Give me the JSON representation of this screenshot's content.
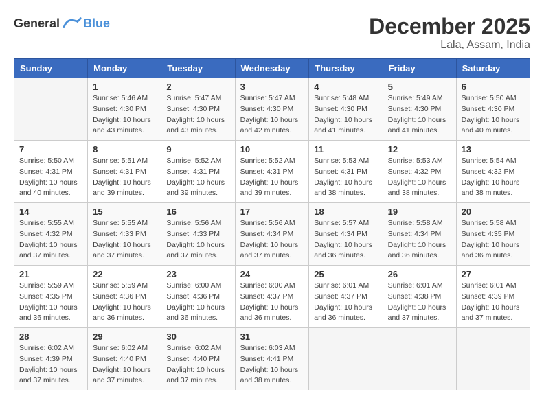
{
  "header": {
    "logo_general": "General",
    "logo_blue": "Blue",
    "month": "December 2025",
    "location": "Lala, Assam, India"
  },
  "weekdays": [
    "Sunday",
    "Monday",
    "Tuesday",
    "Wednesday",
    "Thursday",
    "Friday",
    "Saturday"
  ],
  "weeks": [
    [
      {
        "day": "",
        "sunrise": "",
        "sunset": "",
        "daylight": ""
      },
      {
        "day": "1",
        "sunrise": "Sunrise: 5:46 AM",
        "sunset": "Sunset: 4:30 PM",
        "daylight": "Daylight: 10 hours and 43 minutes."
      },
      {
        "day": "2",
        "sunrise": "Sunrise: 5:47 AM",
        "sunset": "Sunset: 4:30 PM",
        "daylight": "Daylight: 10 hours and 43 minutes."
      },
      {
        "day": "3",
        "sunrise": "Sunrise: 5:47 AM",
        "sunset": "Sunset: 4:30 PM",
        "daylight": "Daylight: 10 hours and 42 minutes."
      },
      {
        "day": "4",
        "sunrise": "Sunrise: 5:48 AM",
        "sunset": "Sunset: 4:30 PM",
        "daylight": "Daylight: 10 hours and 41 minutes."
      },
      {
        "day": "5",
        "sunrise": "Sunrise: 5:49 AM",
        "sunset": "Sunset: 4:30 PM",
        "daylight": "Daylight: 10 hours and 41 minutes."
      },
      {
        "day": "6",
        "sunrise": "Sunrise: 5:50 AM",
        "sunset": "Sunset: 4:30 PM",
        "daylight": "Daylight: 10 hours and 40 minutes."
      }
    ],
    [
      {
        "day": "7",
        "sunrise": "Sunrise: 5:50 AM",
        "sunset": "Sunset: 4:31 PM",
        "daylight": "Daylight: 10 hours and 40 minutes."
      },
      {
        "day": "8",
        "sunrise": "Sunrise: 5:51 AM",
        "sunset": "Sunset: 4:31 PM",
        "daylight": "Daylight: 10 hours and 39 minutes."
      },
      {
        "day": "9",
        "sunrise": "Sunrise: 5:52 AM",
        "sunset": "Sunset: 4:31 PM",
        "daylight": "Daylight: 10 hours and 39 minutes."
      },
      {
        "day": "10",
        "sunrise": "Sunrise: 5:52 AM",
        "sunset": "Sunset: 4:31 PM",
        "daylight": "Daylight: 10 hours and 39 minutes."
      },
      {
        "day": "11",
        "sunrise": "Sunrise: 5:53 AM",
        "sunset": "Sunset: 4:31 PM",
        "daylight": "Daylight: 10 hours and 38 minutes."
      },
      {
        "day": "12",
        "sunrise": "Sunrise: 5:53 AM",
        "sunset": "Sunset: 4:32 PM",
        "daylight": "Daylight: 10 hours and 38 minutes."
      },
      {
        "day": "13",
        "sunrise": "Sunrise: 5:54 AM",
        "sunset": "Sunset: 4:32 PM",
        "daylight": "Daylight: 10 hours and 38 minutes."
      }
    ],
    [
      {
        "day": "14",
        "sunrise": "Sunrise: 5:55 AM",
        "sunset": "Sunset: 4:32 PM",
        "daylight": "Daylight: 10 hours and 37 minutes."
      },
      {
        "day": "15",
        "sunrise": "Sunrise: 5:55 AM",
        "sunset": "Sunset: 4:33 PM",
        "daylight": "Daylight: 10 hours and 37 minutes."
      },
      {
        "day": "16",
        "sunrise": "Sunrise: 5:56 AM",
        "sunset": "Sunset: 4:33 PM",
        "daylight": "Daylight: 10 hours and 37 minutes."
      },
      {
        "day": "17",
        "sunrise": "Sunrise: 5:56 AM",
        "sunset": "Sunset: 4:34 PM",
        "daylight": "Daylight: 10 hours and 37 minutes."
      },
      {
        "day": "18",
        "sunrise": "Sunrise: 5:57 AM",
        "sunset": "Sunset: 4:34 PM",
        "daylight": "Daylight: 10 hours and 36 minutes."
      },
      {
        "day": "19",
        "sunrise": "Sunrise: 5:58 AM",
        "sunset": "Sunset: 4:34 PM",
        "daylight": "Daylight: 10 hours and 36 minutes."
      },
      {
        "day": "20",
        "sunrise": "Sunrise: 5:58 AM",
        "sunset": "Sunset: 4:35 PM",
        "daylight": "Daylight: 10 hours and 36 minutes."
      }
    ],
    [
      {
        "day": "21",
        "sunrise": "Sunrise: 5:59 AM",
        "sunset": "Sunset: 4:35 PM",
        "daylight": "Daylight: 10 hours and 36 minutes."
      },
      {
        "day": "22",
        "sunrise": "Sunrise: 5:59 AM",
        "sunset": "Sunset: 4:36 PM",
        "daylight": "Daylight: 10 hours and 36 minutes."
      },
      {
        "day": "23",
        "sunrise": "Sunrise: 6:00 AM",
        "sunset": "Sunset: 4:36 PM",
        "daylight": "Daylight: 10 hours and 36 minutes."
      },
      {
        "day": "24",
        "sunrise": "Sunrise: 6:00 AM",
        "sunset": "Sunset: 4:37 PM",
        "daylight": "Daylight: 10 hours and 36 minutes."
      },
      {
        "day": "25",
        "sunrise": "Sunrise: 6:01 AM",
        "sunset": "Sunset: 4:37 PM",
        "daylight": "Daylight: 10 hours and 36 minutes."
      },
      {
        "day": "26",
        "sunrise": "Sunrise: 6:01 AM",
        "sunset": "Sunset: 4:38 PM",
        "daylight": "Daylight: 10 hours and 37 minutes."
      },
      {
        "day": "27",
        "sunrise": "Sunrise: 6:01 AM",
        "sunset": "Sunset: 4:39 PM",
        "daylight": "Daylight: 10 hours and 37 minutes."
      }
    ],
    [
      {
        "day": "28",
        "sunrise": "Sunrise: 6:02 AM",
        "sunset": "Sunset: 4:39 PM",
        "daylight": "Daylight: 10 hours and 37 minutes."
      },
      {
        "day": "29",
        "sunrise": "Sunrise: 6:02 AM",
        "sunset": "Sunset: 4:40 PM",
        "daylight": "Daylight: 10 hours and 37 minutes."
      },
      {
        "day": "30",
        "sunrise": "Sunrise: 6:02 AM",
        "sunset": "Sunset: 4:40 PM",
        "daylight": "Daylight: 10 hours and 37 minutes."
      },
      {
        "day": "31",
        "sunrise": "Sunrise: 6:03 AM",
        "sunset": "Sunset: 4:41 PM",
        "daylight": "Daylight: 10 hours and 38 minutes."
      },
      {
        "day": "",
        "sunrise": "",
        "sunset": "",
        "daylight": ""
      },
      {
        "day": "",
        "sunrise": "",
        "sunset": "",
        "daylight": ""
      },
      {
        "day": "",
        "sunrise": "",
        "sunset": "",
        "daylight": ""
      }
    ]
  ]
}
